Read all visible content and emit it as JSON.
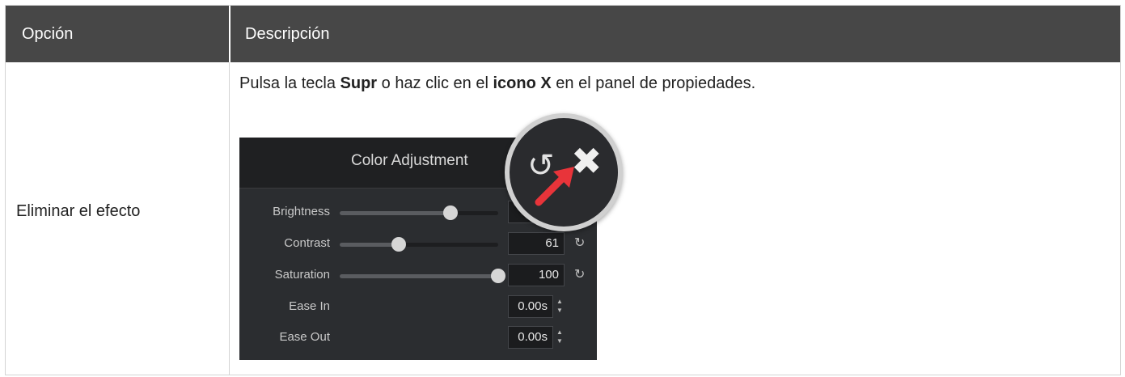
{
  "table": {
    "header": {
      "col1": "Opción",
      "col2": "Descripción"
    },
    "row": {
      "option": "Eliminar el efecto",
      "desc": {
        "part1": "Pulsa la tecla ",
        "key": "Supr",
        "part2": " o haz clic en el ",
        "icon_label": "icono X",
        "part3": " en el panel de propiedades."
      }
    }
  },
  "panel": {
    "title": "Color Adjustment",
    "sliders": [
      {
        "label": "Brightness",
        "value": "",
        "level": 0.7
      },
      {
        "label": "Contrast",
        "value": "61",
        "level": 0.37
      },
      {
        "label": "Saturation",
        "value": "100",
        "level": 1.0
      }
    ],
    "timings": [
      {
        "label": "Ease In",
        "value": "0.00s"
      },
      {
        "label": "Ease Out",
        "value": "0.00s"
      }
    ],
    "icons": {
      "reset": "reset-icon",
      "close": "close-x-icon",
      "pointer": "red-arrow"
    },
    "colors": {
      "header_bg": "#474747",
      "arrow": "#e8343a",
      "panel_bg": "#2b2d30"
    }
  }
}
